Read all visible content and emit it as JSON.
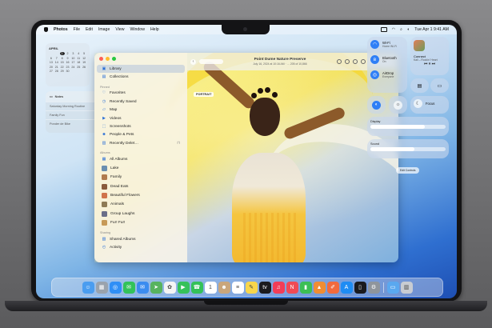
{
  "menubar": {
    "app_name": "Photos",
    "menus": [
      "File",
      "Edit",
      "Image",
      "View",
      "Window",
      "Help"
    ],
    "clock": "Tue Apr 1  9:41 AM"
  },
  "calendar_widget": {
    "month": "APRIL",
    "days": [
      "",
      "",
      "1",
      "2",
      "3",
      "4",
      "5",
      "6",
      "7",
      "8",
      "9",
      "10",
      "11",
      "12",
      "13",
      "14",
      "15",
      "16",
      "17",
      "18",
      "19",
      "20",
      "21",
      "22",
      "23",
      "24",
      "25",
      "26",
      "27",
      "28",
      "29",
      "30"
    ],
    "today": "1"
  },
  "reminders_widget": {
    "title": "Notes",
    "items": [
      "Saturday Morning Routine",
      "Family Fun",
      "Ponder de Bike"
    ]
  },
  "photos": {
    "sidebar": {
      "top_items": [
        {
          "label": "Library",
          "icon": "library-icon"
        },
        {
          "label": "Collections",
          "icon": "collections-icon"
        }
      ],
      "section_pinned": "Pinned",
      "pinned_items": [
        {
          "label": "Favorites",
          "icon": "heart-icon"
        },
        {
          "label": "Recently Saved",
          "icon": "clock-icon"
        },
        {
          "label": "Map",
          "icon": "map-icon"
        },
        {
          "label": "Videos",
          "icon": "video-icon"
        },
        {
          "label": "Screenshots",
          "icon": "screenshot-icon"
        },
        {
          "label": "People & Pets",
          "icon": "people-icon"
        },
        {
          "label": "Recently Delet…",
          "icon": "trash-icon"
        }
      ],
      "section_albums": "Albums",
      "album_items": [
        {
          "label": "All Albums",
          "icon": "albums-icon",
          "color": ""
        },
        {
          "label": "Lake",
          "icon": "album-thumb",
          "color": "#6a8fb0"
        },
        {
          "label": "Family",
          "icon": "album-thumb",
          "color": "#b07a4e"
        },
        {
          "label": "Dead Eats",
          "icon": "album-thumb",
          "color": "#8a5a3b"
        },
        {
          "label": "Beautiful Flowers",
          "icon": "album-thumb",
          "color": "#d0734a"
        },
        {
          "label": "Animals",
          "icon": "album-thumb",
          "color": "#8f7b55"
        },
        {
          "label": "Group Laughs",
          "icon": "album-thumb",
          "color": "#6b6f88"
        },
        {
          "label": "Fur! Fur!",
          "icon": "album-thumb",
          "color": "#c79a58"
        }
      ],
      "section_sharing": "Sharing",
      "sharing_items": [
        {
          "label": "Shared Albums",
          "icon": "shared-albums-icon"
        },
        {
          "label": "Activity",
          "icon": "activity-icon"
        }
      ]
    },
    "toolbar": {
      "title": "Point Dume Nature Preserve",
      "subtitle": "July 16, 2024 at 10:16 AM   ·   …   205 of 10,866"
    },
    "photo_tag": "PORTRAIT"
  },
  "control_center": {
    "wifi": {
      "title": "Wi-Fi",
      "sub": "Home Wi-Fi"
    },
    "bluetooth": {
      "title": "Bluetooth",
      "sub": "On"
    },
    "airdrop": {
      "title": "AirDrop",
      "sub": "Everyone"
    },
    "now_playing": {
      "title": "Connect",
      "sub": "Kali – Rockin' Heart"
    },
    "focus": {
      "title": "Focus"
    },
    "display": {
      "label": "Display",
      "level": 0.72
    },
    "sound": {
      "label": "Sound",
      "level": 0.58
    },
    "edit_controls": "Edit Controls"
  },
  "dock": {
    "apps": [
      {
        "name": "finder-icon",
        "color": "#4a9df0",
        "glyph": "☺"
      },
      {
        "name": "launchpad-icon",
        "color": "#9aa3ad",
        "glyph": "▦"
      },
      {
        "name": "safari-icon",
        "color": "#2f8ff6",
        "glyph": "◎"
      },
      {
        "name": "messages-icon",
        "color": "#33c35a",
        "glyph": "✉"
      },
      {
        "name": "mail-icon",
        "color": "#3b8cf0",
        "glyph": "✉"
      },
      {
        "name": "maps-icon",
        "color": "#57b35f",
        "glyph": "➤"
      },
      {
        "name": "photos-icon",
        "color": "#f4f4f4",
        "glyph": "✿"
      },
      {
        "name": "facetime-icon",
        "color": "#35c15a",
        "glyph": "▶"
      },
      {
        "name": "phone-icon",
        "color": "#34c159",
        "glyph": "☎"
      },
      {
        "name": "calendar-icon",
        "color": "#ffffff",
        "glyph": "1"
      },
      {
        "name": "contacts-icon",
        "color": "#c9a67c",
        "glyph": "☻"
      },
      {
        "name": "reminders-icon",
        "color": "#ffffff",
        "glyph": "≡"
      },
      {
        "name": "notes-icon",
        "color": "#f7d64b",
        "glyph": "✎"
      },
      {
        "name": "tv-icon",
        "color": "#1b1b1e",
        "glyph": "tv"
      },
      {
        "name": "music-icon",
        "color": "#f23d57",
        "glyph": "♫"
      },
      {
        "name": "news-icon",
        "color": "#f04a56",
        "glyph": "N"
      },
      {
        "name": "numbers-icon",
        "color": "#3cbf55",
        "glyph": "▮"
      },
      {
        "name": "keynote-icon",
        "color": "#f08d33",
        "glyph": "▲"
      },
      {
        "name": "pages-icon",
        "color": "#f26a3d",
        "glyph": "✐"
      },
      {
        "name": "app-store-icon",
        "color": "#1e8cf4",
        "glyph": "A"
      },
      {
        "name": "iphone-mirroring-icon",
        "color": "#1a1a1e",
        "glyph": "▯"
      },
      {
        "name": "system-settings-icon",
        "color": "#8f959c",
        "glyph": "⚙"
      }
    ],
    "trailing": [
      {
        "name": "downloads-folder-icon",
        "color": "#5aa8ef",
        "glyph": "▭"
      },
      {
        "name": "trash-icon",
        "color": "#c8ccd2",
        "glyph": "▥"
      }
    ]
  }
}
